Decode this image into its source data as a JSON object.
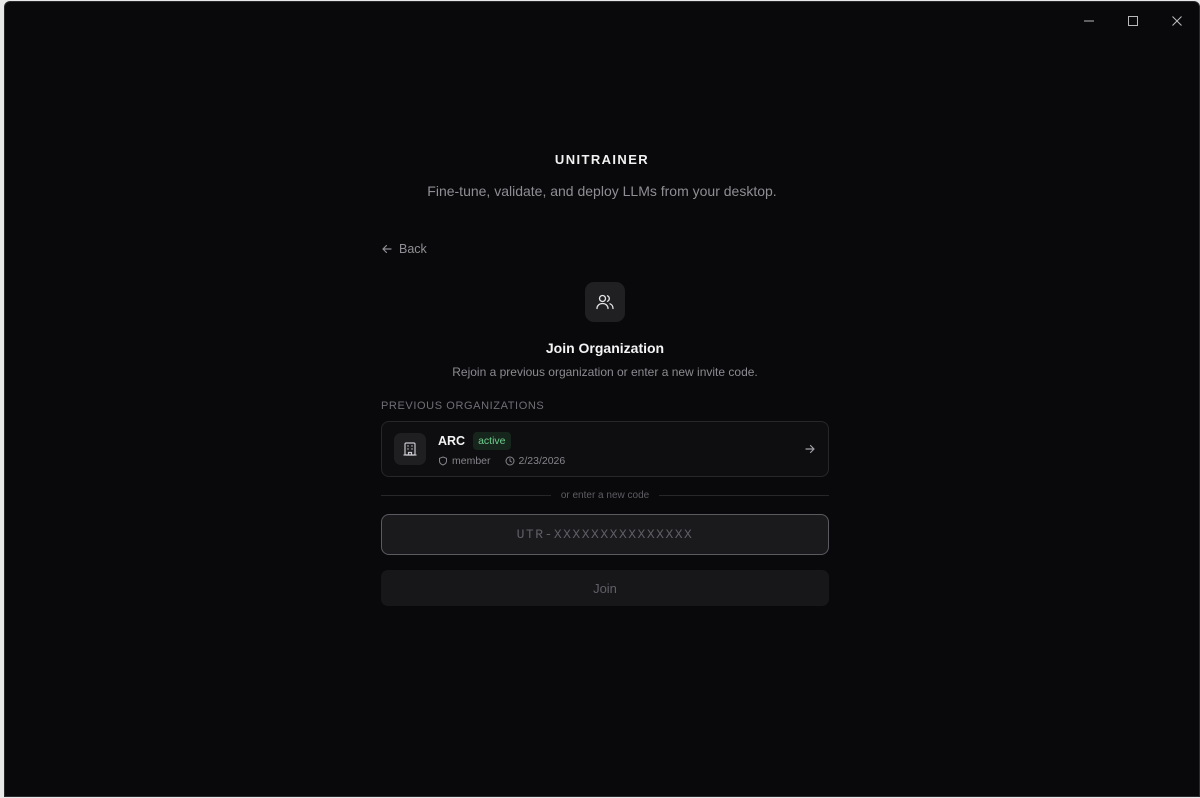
{
  "window": {
    "controls": [
      "minimize-icon",
      "maximize-icon",
      "close-icon"
    ]
  },
  "app": {
    "brand": "UNITRAINER",
    "tagline": "Fine-tune, validate, and deploy LLMs from your desktop."
  },
  "join": {
    "back_label": "Back",
    "title": "Join Organization",
    "description": "Rejoin a previous organization or enter a new invite code.",
    "previous_label": "PREVIOUS ORGANIZATIONS",
    "organizations": [
      {
        "name": "ARC",
        "status": "active",
        "role": "member",
        "date": "2/23/2026"
      }
    ],
    "divider_text": "or enter a new code",
    "code_placeholder": "UTR-XXXXXXXXXXXXXXX",
    "code_value": "",
    "join_label": "Join"
  },
  "colors": {
    "background": "#09090b",
    "card": "#0e0e10",
    "active_badge": "#6fcf8e"
  }
}
